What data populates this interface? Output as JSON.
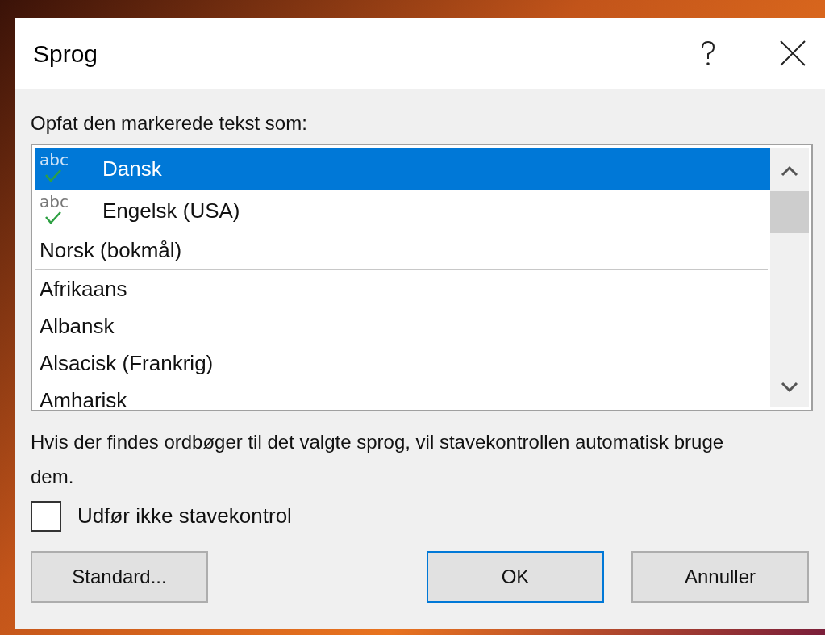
{
  "window": {
    "title": "Sprog"
  },
  "list_label": "Opfat den markerede tekst som:",
  "languages": [
    {
      "kind": "spell",
      "icon_text": "abc",
      "label": "Dansk",
      "selected": true
    },
    {
      "kind": "spell",
      "icon_text": "abc",
      "label": "Engelsk (USA)",
      "selected": false
    },
    {
      "kind": "plain",
      "label": "Norsk (bokmål)",
      "selected": false
    },
    {
      "kind": "separator"
    },
    {
      "kind": "plain",
      "label": "Afrikaans",
      "selected": false
    },
    {
      "kind": "plain",
      "label": "Albansk",
      "selected": false
    },
    {
      "kind": "plain",
      "label": "Alsacisk (Frankrig)",
      "selected": false
    },
    {
      "kind": "plain",
      "label": "Amharisk",
      "selected": false
    }
  ],
  "description": "Hvis der findes ordbøger til det valgte sprog, vil stavekontrollen automatisk bruge dem.",
  "no_spellcheck": {
    "label": "Udfør ikke stavekontrol",
    "checked": false
  },
  "buttons": [
    {
      "label": "Standard...",
      "default": false
    },
    {
      "label": "OK",
      "default": true
    },
    {
      "label": "Annuller",
      "default": false
    }
  ]
}
